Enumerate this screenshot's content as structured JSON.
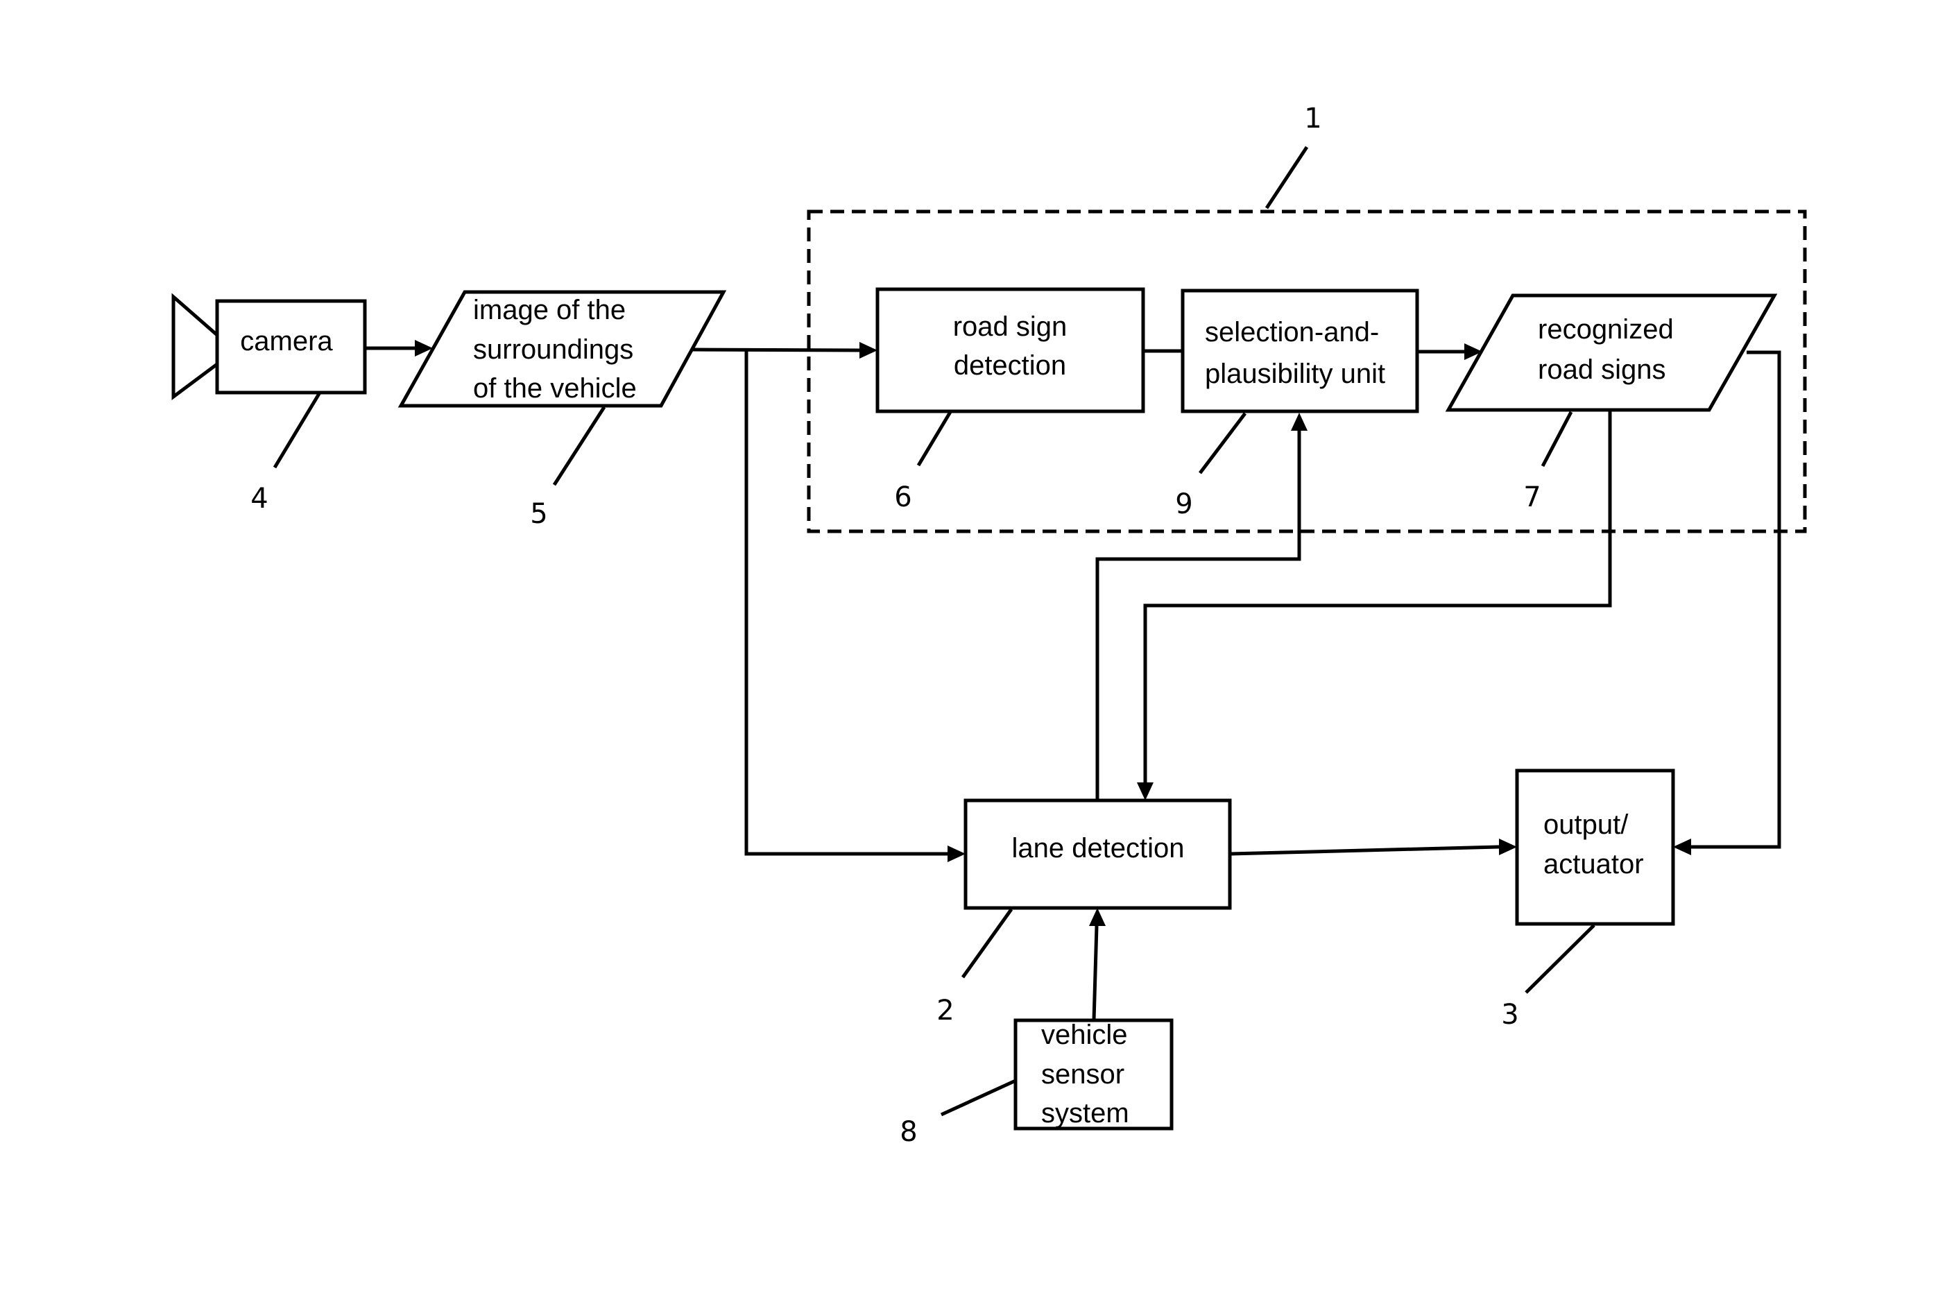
{
  "diagram": {
    "type": "block-diagram",
    "system_boundary": {
      "ref": "1"
    },
    "nodes": {
      "camera": {
        "ref": "4",
        "lines": [
          "camera"
        ],
        "shape": "box-with-lens"
      },
      "image": {
        "ref": "5",
        "lines": [
          "image of the",
          "surroundings",
          "of the vehicle"
        ],
        "shape": "parallelogram"
      },
      "road_sign_detection": {
        "ref": "6",
        "lines": [
          "road sign",
          "detection"
        ],
        "shape": "box"
      },
      "selection_unit": {
        "ref": "9",
        "lines": [
          "selection-and-",
          "plausibility unit"
        ],
        "shape": "box"
      },
      "recognized_signs": {
        "ref": "7",
        "lines": [
          "recognized",
          "road signs"
        ],
        "shape": "parallelogram"
      },
      "lane_detection": {
        "ref": "2",
        "lines": [
          "lane detection"
        ],
        "shape": "box"
      },
      "output_actuator": {
        "ref": "3",
        "lines": [
          "output/",
          "actuator"
        ],
        "shape": "box"
      },
      "vehicle_sensor": {
        "ref": "8",
        "lines": [
          "vehicle",
          "sensor",
          "system"
        ],
        "shape": "box"
      }
    },
    "edges": [
      {
        "from": "camera",
        "to": "image",
        "arrow": true
      },
      {
        "from": "image",
        "to": "road_sign_detection",
        "arrow": true
      },
      {
        "from": "image",
        "to": "lane_detection",
        "arrow": true
      },
      {
        "from": "road_sign_detection",
        "to": "selection_unit",
        "arrow": false
      },
      {
        "from": "selection_unit",
        "to": "recognized_signs",
        "arrow": true
      },
      {
        "from": "lane_detection",
        "to": "selection_unit",
        "arrow": true
      },
      {
        "from": "recognized_signs",
        "to": "lane_detection",
        "arrow": true
      },
      {
        "from": "recognized_signs",
        "to": "output_actuator",
        "arrow": true
      },
      {
        "from": "lane_detection",
        "to": "output_actuator",
        "arrow": true
      },
      {
        "from": "vehicle_sensor",
        "to": "lane_detection",
        "arrow": true
      }
    ]
  }
}
